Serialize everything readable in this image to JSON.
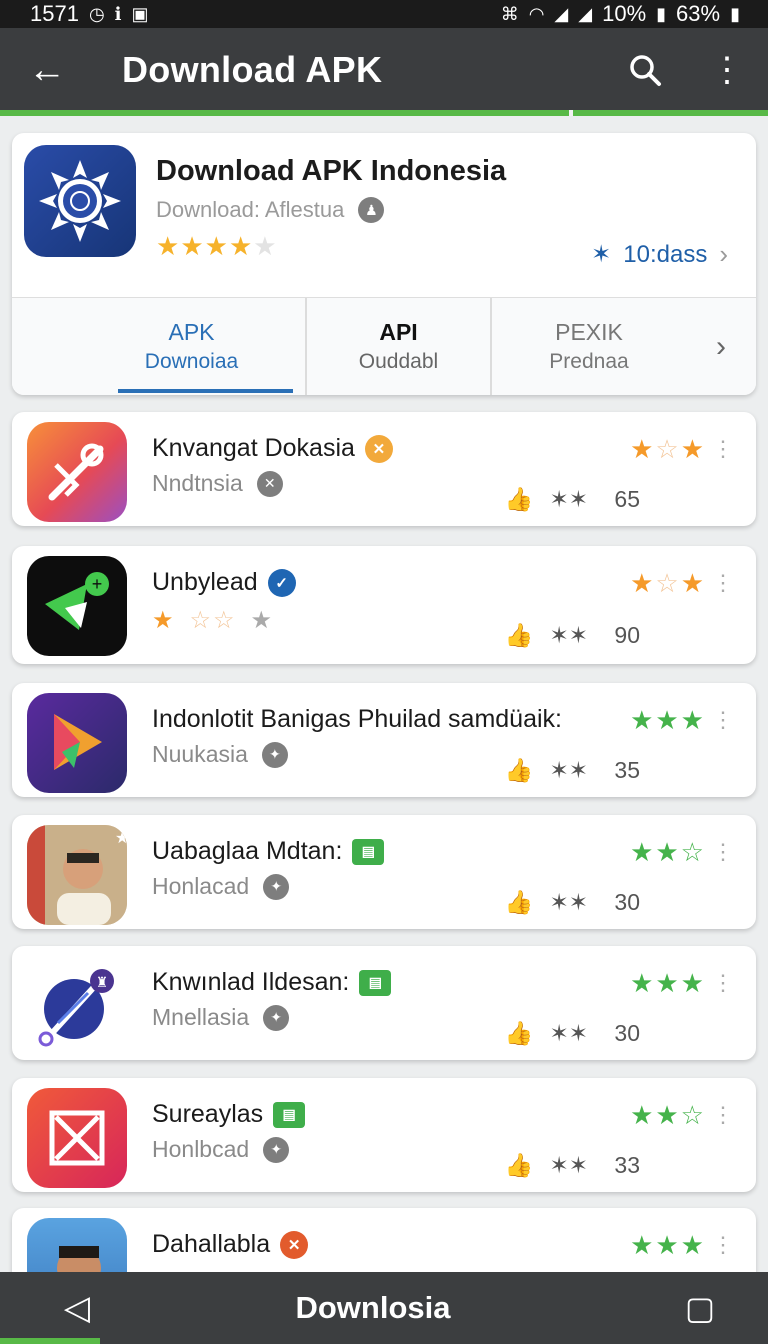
{
  "statusbar": {
    "time": "1571",
    "left_icons": [
      "clock-icon",
      "notification-icon",
      "photo-icon"
    ],
    "signal_pct": "10%",
    "battery_pct": "63%"
  },
  "appbar": {
    "back": "←",
    "title": "Download APK",
    "search": "⚲",
    "more": "⋮"
  },
  "hero": {
    "title": "Download APK Indonesia",
    "subtitle": "Download: Aflestua",
    "rating": 4,
    "count": "10:dass",
    "tabs": [
      {
        "line1": "APK",
        "line2": "Downoiaa",
        "active": true
      },
      {
        "line1": "API",
        "line2": "Ouddabl"
      },
      {
        "line1": "PEXIK",
        "line2": "Prednaa"
      }
    ]
  },
  "apps": [
    {
      "name": "Knvangat Dokasia",
      "sub": "Nndtnsia",
      "count": "65",
      "badge": "orange",
      "stars": "★☆★",
      "star_color": "orange"
    },
    {
      "name": "Unbylead",
      "sub": "",
      "count": "90",
      "badge": "blue",
      "stars": "★☆★",
      "star_color": "orange",
      "sub_stars": "★☆☆★"
    },
    {
      "name": "Indonlotit Banigas Phuilad samdüaik:",
      "sub": "Nuukasia",
      "count": "35",
      "badge": "",
      "stars": "★★★",
      "star_color": "green"
    },
    {
      "name": "Uabaglaa Mdtan:",
      "sub": "Honlacad",
      "count": "30",
      "badge": "green",
      "stars": "★★☆",
      "star_color": "green"
    },
    {
      "name": "Knwınlad Ildesan:",
      "sub": "Mnellasia",
      "count": "30",
      "badge": "green",
      "stars": "★★★",
      "star_color": "green"
    },
    {
      "name": "Sureaylas",
      "sub": "Honlbcad",
      "count": "33",
      "badge": "green",
      "stars": "★★☆",
      "star_color": "green"
    },
    {
      "name": "Dahallabla",
      "sub": "",
      "count": "",
      "badge": "red",
      "stars": "★★★",
      "star_color": "green"
    }
  ],
  "bottombar": {
    "back": "◁",
    "label": "Downlosia",
    "recents": "▢"
  }
}
